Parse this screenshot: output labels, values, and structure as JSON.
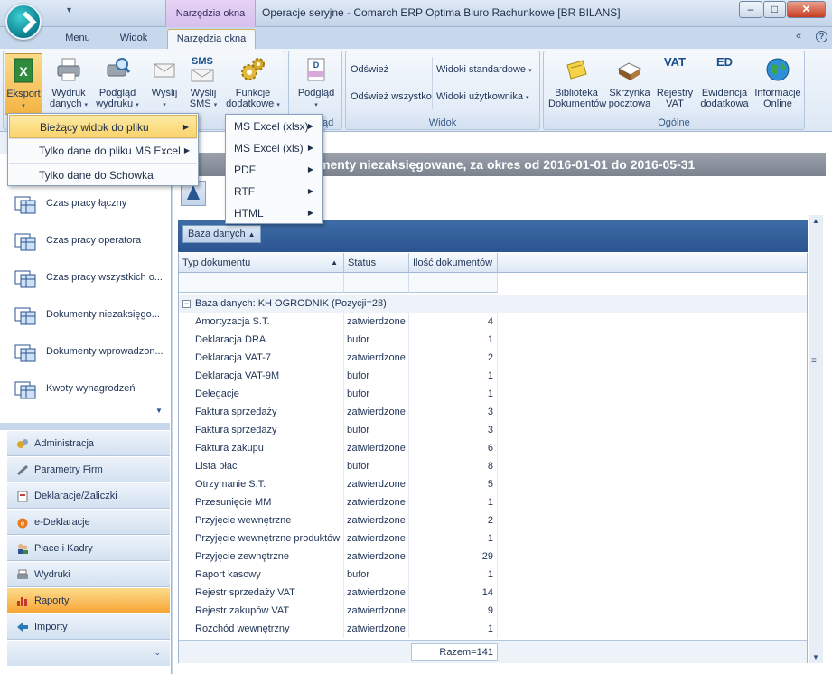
{
  "titlebar": {
    "context_tab_group": "Narzędzia okna",
    "title": "Operacje seryjne - Comarch ERP Optima Biuro Rachunkowe [BR BILANS]",
    "minimize": "–",
    "maximize": "□",
    "close": "✕"
  },
  "tabs": [
    "Menu",
    "Widok",
    "Narzędzia okna"
  ],
  "ribbon_top_right": "«",
  "ribbon": {
    "export": {
      "buttons": [
        {
          "label": "Eksport",
          "caret": "▾"
        },
        {
          "label": "Wydruk",
          "label2": "danych",
          "caret": "▾"
        },
        {
          "label": "Podgląd",
          "label2": "wydruku",
          "caret": "▾"
        },
        {
          "label": "Wyślij",
          "caret": "▾"
        },
        {
          "label": "Wyślij",
          "label2": "SMS",
          "caret": "▾"
        },
        {
          "label": "Funkcje",
          "label2": "dodatkowe",
          "caret": "▾"
        }
      ]
    },
    "preview": {
      "label": "Podgląd",
      "caret": "▾",
      "group_label": "Podgląd"
    },
    "view": {
      "buttons": [
        "Odśwież",
        "Odśwież wszystko"
      ],
      "dropdowns": [
        "Widoki standardowe",
        "Widoki użytkownika"
      ],
      "group_label": "Widok"
    },
    "general": {
      "buttons": [
        {
          "label": "Biblioteka",
          "label2": "Dokumentów"
        },
        {
          "label": "Skrzynka",
          "label2": "pocztowa"
        },
        {
          "label": "Rejestry",
          "label2": "VAT"
        },
        {
          "label": "Ewidencja",
          "label2": "dodatkowa"
        },
        {
          "label": "Informacje",
          "label2": "Online"
        }
      ],
      "icon_texts": [
        "VAT",
        "ED",
        "SMS"
      ],
      "group_label": "Ogólne"
    }
  },
  "export_menu": {
    "items": [
      "Bieżący widok do pliku",
      "Tylko dane do pliku MS Excel",
      "Tylko dane do Schowka"
    ],
    "submenu": [
      "MS Excel (xlsx)",
      "MS Excel (xls)",
      "PDF",
      "RTF",
      "HTML"
    ]
  },
  "sidebar": {
    "reports": [
      "Czas pracy łączny",
      "Czas pracy operatora",
      "Czas pracy wszystkich o...",
      "Dokumenty niezaksięgo...",
      "Dokumenty wprowadzon...",
      "Kwoty wynagrodzeń"
    ],
    "modules": [
      "Administracja",
      "Parametry Firm",
      "Deklaracje/Zaliczki",
      "e-Deklaracje",
      "Płace i Kadry",
      "Wydruki",
      "Raporty",
      "Importy"
    ],
    "active_module": "Raporty"
  },
  "report": {
    "title": "Dokumenty niezaksięgowane, za okres od 2016-01-01 do 2016-05-31",
    "title_visible": "menty niezaksięgowane, za okres od 2016-01-01 do 2016-05-31",
    "group_chip": "Baza danych",
    "group_chip_caret": "▲",
    "columns": [
      "Typ dokumentu",
      "Status",
      "Ilość dokumentów"
    ],
    "group_row": "Baza danych: KH OGRODNIK (Pozycji=28)",
    "rows": [
      [
        "Amortyzacja S.T.",
        "zatwierdzone",
        "4"
      ],
      [
        "Deklaracja DRA",
        "bufor",
        "1"
      ],
      [
        "Deklaracja VAT-7",
        "zatwierdzone",
        "2"
      ],
      [
        "Deklaracja VAT-9M",
        "bufor",
        "1"
      ],
      [
        "Delegacje",
        "bufor",
        "1"
      ],
      [
        "Faktura sprzedaży",
        "zatwierdzone",
        "3"
      ],
      [
        "Faktura sprzedaży",
        "bufor",
        "3"
      ],
      [
        "Faktura zakupu",
        "zatwierdzone",
        "6"
      ],
      [
        "Lista płac",
        "bufor",
        "8"
      ],
      [
        "Otrzymanie S.T.",
        "zatwierdzone",
        "5"
      ],
      [
        "Przesunięcie MM",
        "zatwierdzone",
        "1"
      ],
      [
        "Przyjęcie wewnętrzne",
        "zatwierdzone",
        "2"
      ],
      [
        "Przyjęcie wewnętrzne produktów",
        "zatwierdzone",
        "1"
      ],
      [
        "Przyjęcie zewnętrzne",
        "zatwierdzone",
        "29"
      ],
      [
        "Raport kasowy",
        "bufor",
        "1"
      ],
      [
        "Rejestr sprzedaży VAT",
        "zatwierdzone",
        "14"
      ],
      [
        "Rejestr zakupów VAT",
        "zatwierdzone",
        "9"
      ],
      [
        "Rozchód wewnętrzny",
        "zatwierdzone",
        "1"
      ]
    ],
    "sum": "Razem=141"
  }
}
